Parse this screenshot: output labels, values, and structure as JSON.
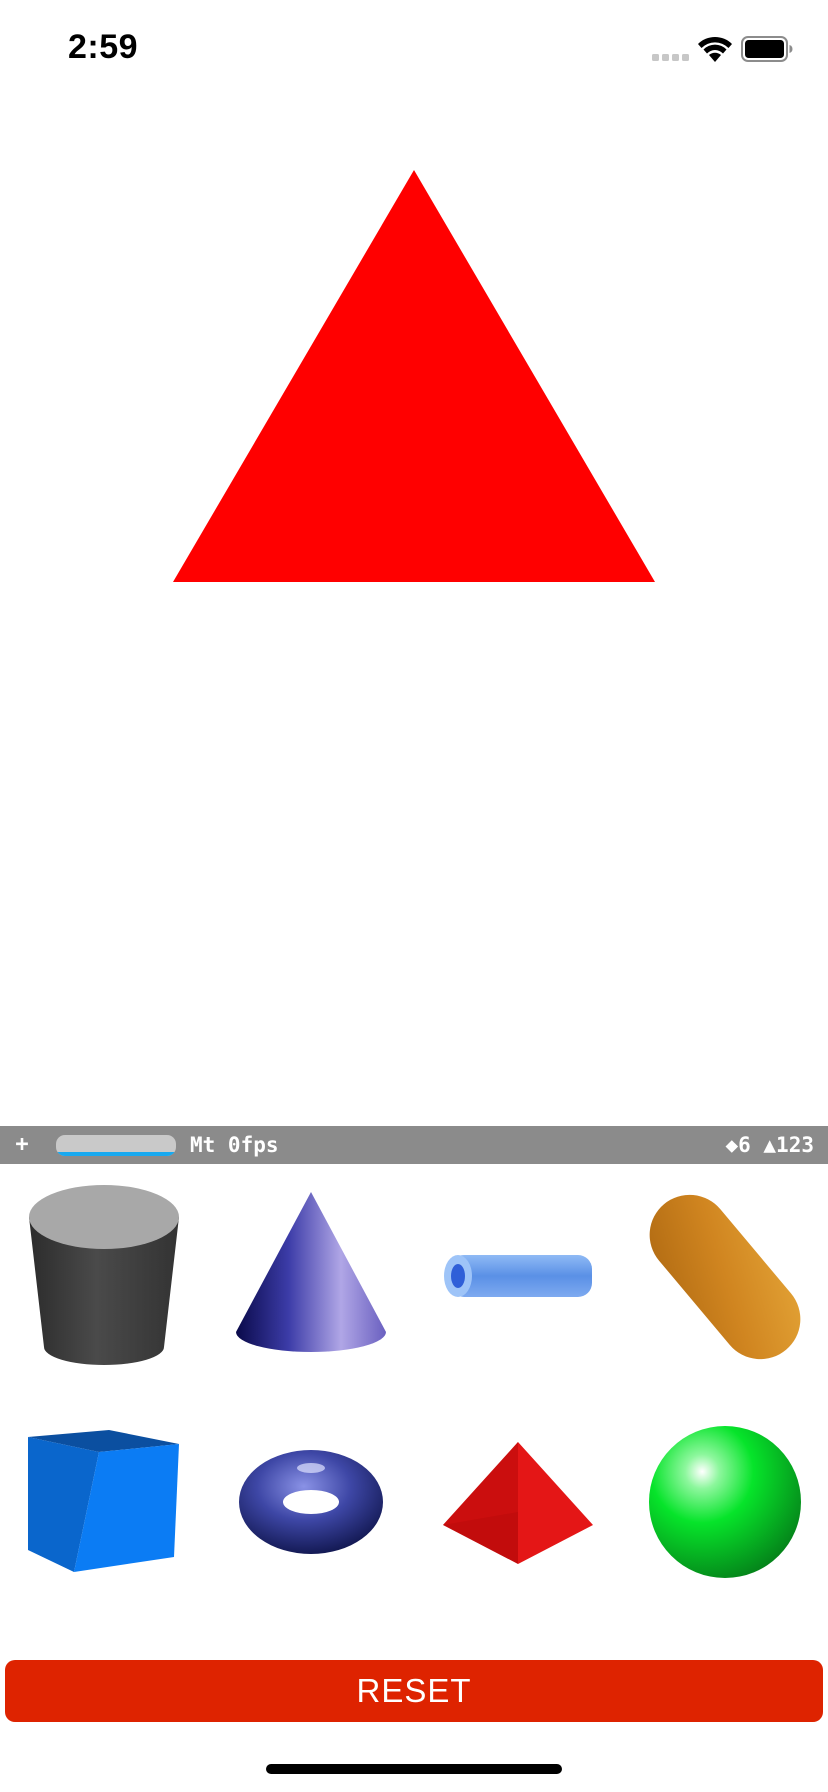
{
  "status_bar": {
    "time": "2:59"
  },
  "scene": {
    "shape_color": "#ff0000"
  },
  "stats": {
    "plus_label": "+",
    "fps_text": "Mt 0fps",
    "counts_text": "◆6 ▲123",
    "gauge_fill_fraction": 1.0,
    "gauge_fill_color": "#18a9f0"
  },
  "shapes": [
    {
      "name": "cylinder",
      "icon": "cylinder-icon"
    },
    {
      "name": "cone",
      "icon": "cone-icon"
    },
    {
      "name": "tube",
      "icon": "tube-icon"
    },
    {
      "name": "capsule",
      "icon": "capsule-icon"
    },
    {
      "name": "box",
      "icon": "box-icon"
    },
    {
      "name": "torus",
      "icon": "torus-icon"
    },
    {
      "name": "pyramid",
      "icon": "pyramid-icon"
    },
    {
      "name": "sphere",
      "icon": "sphere-icon"
    }
  ],
  "colors": {
    "reset_button": "#de2300",
    "stats_bar": "#8b8b8b"
  },
  "reset_label": "RESET"
}
